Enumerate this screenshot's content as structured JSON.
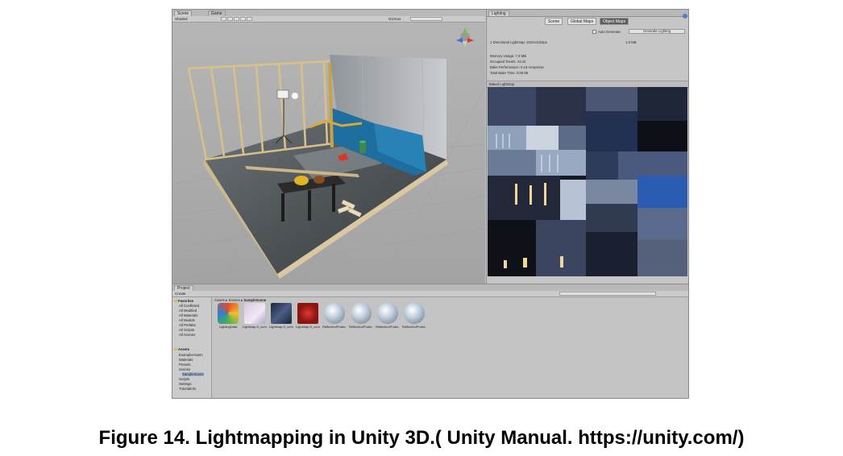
{
  "scene": {
    "tabs": [
      "Scene",
      "Game"
    ],
    "shading_mode": "Shaded",
    "gizmos_label": "Gizmos",
    "search_placeholder": "All"
  },
  "lighting": {
    "tab_title": "Lighting",
    "tabs": [
      "Scene",
      "Global Maps",
      "Object Maps"
    ],
    "auto_generate": "Auto Generate",
    "generate_button": "Generate Lighting",
    "stats": {
      "lightmaps_line": "1 Directional Lightmap: 1024x1024px",
      "lightmaps_size": "1.0 MB",
      "memory": "Memory Usage: 7.9 MB",
      "occupied": "Occupied Texels: 23.1k",
      "bake_perf": "Bake Performance: 0.19 mrays/sec",
      "total_time": "Total Bake Time: 0:00:06"
    },
    "preview_dropdown": "Baked Lightmap"
  },
  "project": {
    "tab_title": "Project",
    "create_button": "Create",
    "breadcrumb": [
      "Assets",
      "Scenes",
      "SampleScene"
    ],
    "favorites": {
      "title": "Favorites",
      "items": [
        "All Conflicted",
        "All Modified",
        "All Materials",
        "All Models",
        "All Prefabs",
        "All Scripts",
        "All Scenes"
      ]
    },
    "assets_tree": {
      "title": "Assets",
      "items": [
        "ExampleAssets",
        "Materials",
        "Presets",
        "Scenes",
        "SampleScene",
        "Scripts",
        "Settings",
        "TutorialInfo"
      ]
    },
    "files": [
      {
        "label": "LightingData",
        "icon": "lighting-data-icon",
        "color": "#e44b2a"
      },
      {
        "label": "Lightmap-0_comp_dir",
        "icon": "lightmap-dir-icon",
        "color": "#d7c6df"
      },
      {
        "label": "Lightmap-0_comp_light",
        "icon": "lightmap-light-icon",
        "color": "#1b2535"
      },
      {
        "label": "Lightmap-0_comp_shadowmask",
        "icon": "lightmap-shadowmask-icon",
        "color": "#8a1512"
      },
      {
        "label": "ReflectionProbe-0",
        "icon": "reflection-probe-icon",
        "color": "#b9c7d6"
      },
      {
        "label": "ReflectionProbe-1",
        "icon": "reflection-probe-icon",
        "color": "#b9c7d6"
      },
      {
        "label": "ReflectionProbe-2",
        "icon": "reflection-probe-icon",
        "color": "#b9c7d6"
      },
      {
        "label": "ReflectionProbe-3",
        "icon": "reflection-probe-icon",
        "color": "#b9c7d6"
      }
    ]
  },
  "caption": "Figure 14. Lightmapping in Unity 3D.( Unity Manual. https://unity.com/)"
}
